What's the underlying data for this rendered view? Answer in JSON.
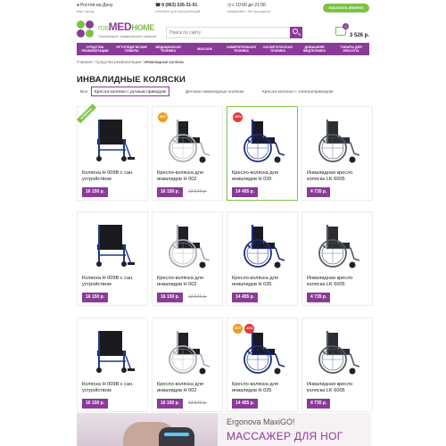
{
  "topbar": {
    "city": "Ростов-на-Дону",
    "city_sub": "ваш город",
    "phone": "8 (863) 226-31-01",
    "phone_sub": "телефон для консультаций",
    "hours": "с 10:00 до 21:00",
    "hours_sub": "ежедневно, без выходных",
    "callback_label": "ЗАКАЗАТЬ ЗВОНОК"
  },
  "logo": {
    "part1": "ros",
    "part2": "MED",
    "part3": "HOME",
    "tagline": "Гипермаркет медицинских товаров"
  },
  "search": {
    "placeholder": "Поиск по сайту"
  },
  "cart": {
    "count": "2",
    "total": "3 526 р."
  },
  "nav": [
    "Средства реабилитации",
    "Ортопедические товары",
    "Медицинская техника",
    "Массаж",
    "Измерительная техника",
    "Косметическая техника",
    "Домашняя медтехника",
    "Товары для красоты"
  ],
  "breadcrumb": {
    "home": "Главная",
    "sep": "/",
    "parent": "Средства реабилитации",
    "current": "Инвалидные коляски"
  },
  "page_title": "ИНВАЛИДНЫЕ КОЛЯСКИ",
  "filters": [
    {
      "label": "Все",
      "active": false
    },
    {
      "label": "Кресла-коляски с ручным приводом",
      "active": true
    },
    {
      "label": "Детские инвалидные коляски",
      "active": false
    },
    {
      "label": "Кресла-коляски с электроприводом",
      "active": false
    }
  ],
  "products": [
    {
      "title": "Коляска H 009B с сан. устройством",
      "price": "16 150 р.",
      "old": "",
      "label": "НОВИНКА",
      "label_type": "new",
      "type": "commode"
    },
    {
      "title": "Кресло-коляска для инвалидов H 002",
      "price": "16 150 р.",
      "old": "13 570 р.",
      "label": "ХИТ",
      "label_type": "hit",
      "type": "chrome"
    },
    {
      "title": "Кресло-коляска для инвалидов H 035",
      "price": "14 455 р.",
      "old": "",
      "label": "-30%",
      "label_type": "pct",
      "type": "blue"
    },
    {
      "title": "Инвалидная кресло коляска LK 6005",
      "price": "4 735 р.",
      "old": "",
      "label": "",
      "label_type": "",
      "type": "gray"
    },
    {
      "title": "Коляска H 009B с сан. устройством",
      "price": "16 150 р.",
      "old": "",
      "label": "",
      "label_type": "",
      "type": "commode"
    },
    {
      "title": "Кресло-коляска для инвалидов H 002",
      "price": "16 150 р.",
      "old": "13 570 р.",
      "label": "",
      "label_type": "",
      "type": "chrome"
    },
    {
      "title": "Кресло-коляска для инвалидов H 035",
      "price": "14 455 р.",
      "old": "",
      "label": "",
      "label_type": "",
      "type": "blue"
    },
    {
      "title": "Инвалидная кресло коляска LK 6005",
      "price": "4 735 р.",
      "old": "",
      "label": "",
      "label_type": "",
      "type": "gray"
    },
    {
      "title": "Коляска H 009B с сан. устройством",
      "price": "16 150 р.",
      "old": "",
      "label": "",
      "label_type": "",
      "type": "commode"
    },
    {
      "title": "Кресло-коляска для инвалидов H 002",
      "price": "16 150 р.",
      "old": "13 570 р.",
      "label": "",
      "label_type": "",
      "type": "chrome"
    },
    {
      "title": "Кресло-коляска для инвалидов H 035",
      "price": "14 455 р.",
      "old": "",
      "label": "ХИТ",
      "label_type": "hit",
      "label2": "-30%",
      "type": "blue"
    },
    {
      "title": "Инвалидная кресло коляска LK 6005",
      "price": "4 735 р.",
      "old": "",
      "label": "",
      "label_type": "",
      "type": "gray"
    }
  ],
  "highlighted_product": 2,
  "promo": {
    "brand": "Ergonova MaxiGO!",
    "headline": "МАССАЖЕР ДЛЯ НОГ"
  },
  "colors": {
    "brand_purple": "#8a3b97",
    "brand_green": "#7dc242",
    "discount_red": "#e53935",
    "hit_orange": "#f29a1f"
  }
}
